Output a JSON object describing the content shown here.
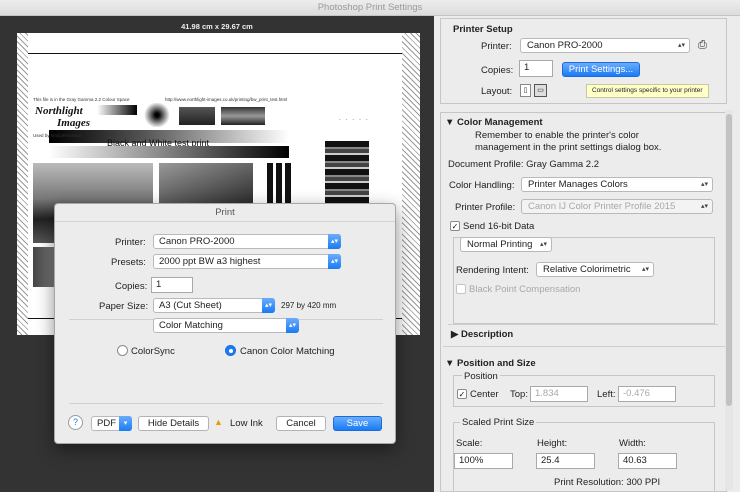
{
  "window": {
    "title": "Photoshop Print Settings"
  },
  "preview": {
    "dimensions": "41.98 cm x 29.67 cm",
    "print_title": "Black and White test print",
    "tiny_text_1": "This file is in the Gray Gamma 2.2 Colour Space",
    "tiny_text_2": "http://www.northlight-images.co.uk/printing/bw_print_test.html",
    "tiny_text_3": "Used by kind permission",
    "tiny_text_4": "Look at the edges",
    "logo_line1": "Northlight",
    "logo_line2": "Images"
  },
  "printer_setup": {
    "heading": "Printer Setup",
    "printer_label": "Printer:",
    "printer_value": "Canon PRO-2000",
    "copies_label": "Copies:",
    "copies_value": "1",
    "print_settings_button": "Print Settings...",
    "layout_label": "Layout:",
    "tooltip": "Control settings specific to your printer"
  },
  "color_management": {
    "heading": "Color Management",
    "reminder": "Remember to enable the printer's color management in the print settings dialog box.",
    "reminder_line1": "Remember to enable the printer's color",
    "reminder_line2": "management in the print settings dialog box.",
    "document_profile": "Document Profile: Gray Gamma 2.2",
    "color_handling_label": "Color Handling:",
    "color_handling_value": "Printer Manages Colors",
    "printer_profile_label": "Printer Profile:",
    "printer_profile_value": "Canon IJ Color Printer Profile 2015",
    "send16_label": "Send 16-bit Data",
    "print_mode_value": "Normal Printing",
    "rendering_intent_label": "Rendering Intent:",
    "rendering_intent_value": "Relative Colorimetric",
    "black_point_label": "Black Point Compensation"
  },
  "description": {
    "heading": "Description"
  },
  "position_size": {
    "heading": "Position and Size",
    "position_label": "Position",
    "center_label": "Center",
    "top_label": "Top:",
    "top_value": "1.834",
    "left_label": "Left:",
    "left_value": "-0.476",
    "scaled_label": "Scaled Print Size",
    "scale_label": "Scale:",
    "scale_value": "100%",
    "height_label": "Height:",
    "height_value": "25.4",
    "width_label": "Width:",
    "width_value": "40.63",
    "resolution": "Print Resolution: 300 PPI"
  },
  "print_dialog": {
    "title": "Print",
    "printer_label": "Printer:",
    "printer_value": "Canon PRO-2000",
    "presets_label": "Presets:",
    "presets_value": "2000 ppt BW a3 highest",
    "copies_label": "Copies:",
    "copies_value": "1",
    "paper_size_label": "Paper Size:",
    "paper_size_value": "A3 (Cut Sheet)",
    "paper_size_dims": "297 by 420 mm",
    "panel_value": "Color Matching",
    "colorsync_label": "ColorSync",
    "canon_matching_label": "Canon Color Matching",
    "help_label": "?",
    "pdf_label": "PDF",
    "hide_details_label": "Hide Details",
    "low_ink_label": "Low Ink",
    "cancel_label": "Cancel",
    "save_label": "Save"
  },
  "colors": {
    "accent": "#1a7bf5",
    "tooltip": "#ffffc7",
    "preview_bg": "#333333"
  }
}
